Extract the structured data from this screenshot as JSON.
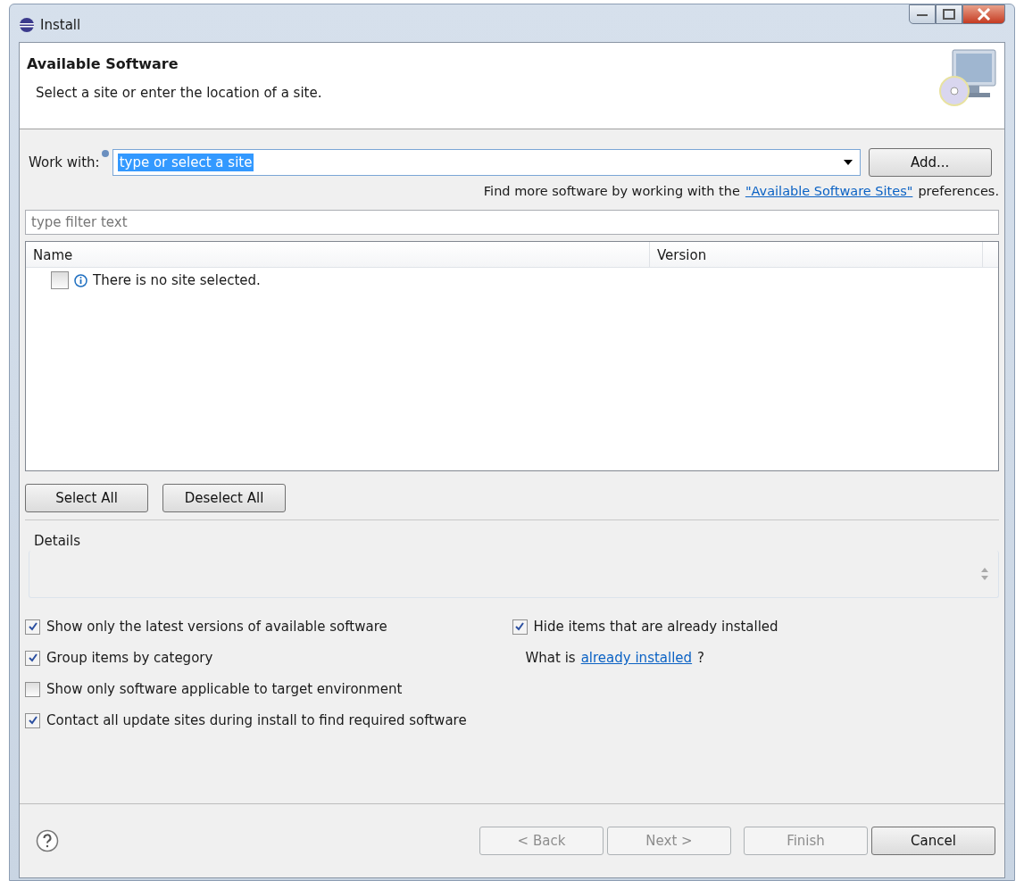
{
  "window": {
    "title": "Install"
  },
  "header": {
    "title": "Available Software",
    "description": "Select a site or enter the location of a site."
  },
  "work_with": {
    "label": "Work with:",
    "value": "type or select a site",
    "highlighted": true,
    "add_button": "Add..."
  },
  "more_software": {
    "before": "Find more software by working with the",
    "link": "\"Available Software Sites\"",
    "after": "preferences."
  },
  "filter": {
    "placeholder": "type filter text"
  },
  "table": {
    "columns": [
      "Name",
      "Version"
    ],
    "rows": [
      {
        "checked": false,
        "text": "There is no site selected."
      }
    ]
  },
  "selection_buttons": [
    "Select All",
    "Deselect All"
  ],
  "details": {
    "label": "Details"
  },
  "options_left": [
    {
      "label": "Show only the latest versions of available software",
      "checked": true
    },
    {
      "label": "Group items by category",
      "checked": true
    },
    {
      "label": "Show only software applicable to target environment",
      "checked": false
    },
    {
      "label": "Contact all update sites during install to find required software",
      "checked": true
    }
  ],
  "options_right": [
    {
      "label": "Hide items that are already installed",
      "checked": true
    }
  ],
  "installed_note": {
    "before": "What is",
    "link": "already installed",
    "after": "?"
  },
  "footer_buttons": [
    {
      "label": "< Back",
      "disabled": true
    },
    {
      "label": "Next >",
      "disabled": true
    },
    {
      "label": "Finish",
      "disabled": true
    },
    {
      "label": "Cancel",
      "disabled": false
    }
  ]
}
